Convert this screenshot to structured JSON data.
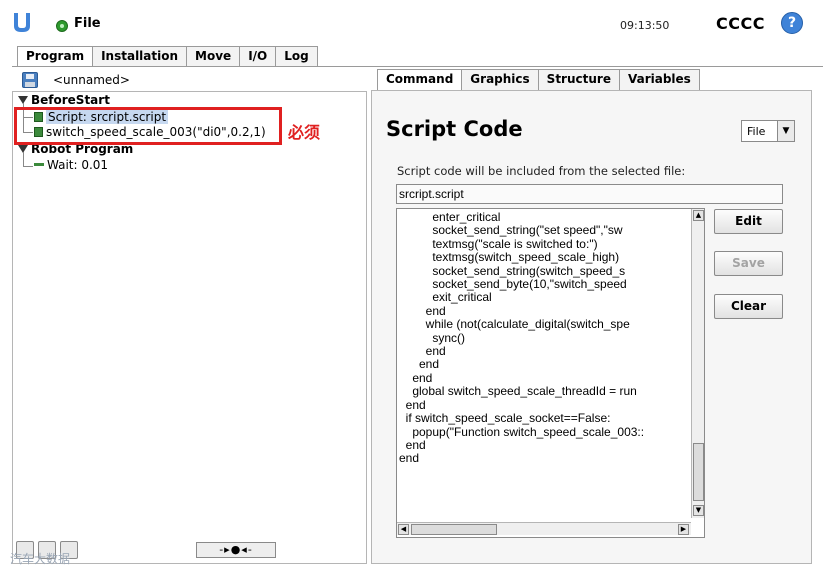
{
  "header": {
    "file_label": "File",
    "clock": "09:13:50",
    "robot_name": "CCCC",
    "help_glyph": "?",
    "logo_icon": "ur-logo-icon",
    "status_color": "#2e9a2e"
  },
  "main_tabs": [
    {
      "label": "Program",
      "active": true
    },
    {
      "label": "Installation",
      "active": false
    },
    {
      "label": "Move",
      "active": false
    },
    {
      "label": "I/O",
      "active": false
    },
    {
      "label": "Log",
      "active": false
    }
  ],
  "program": {
    "file_name": "<unnamed>",
    "tree": {
      "before_start": "BeforeStart",
      "script_node": "Script: srcript.script",
      "function_node": "switch_speed_scale_003(\"di0\",0.2,1)",
      "robot_program": "Robot Program",
      "wait_node": "Wait: 0.01"
    },
    "annotation": "必须",
    "nav_control": "-▸●◂-",
    "watermark": "汽车大数据"
  },
  "sub_tabs": [
    {
      "label": "Command",
      "active": true
    },
    {
      "label": "Graphics",
      "active": false
    },
    {
      "label": "Structure",
      "active": false
    },
    {
      "label": "Variables",
      "active": false
    }
  ],
  "command": {
    "title": "Script Code",
    "file_select": "File",
    "description": "Script code will be included from the selected file:",
    "path": "srcript.script",
    "code_lines": [
      "          enter_critical",
      "          socket_send_string(\"set speed\",\"sw",
      "          textmsg(\"scale is switched to:\")",
      "          textmsg(switch_speed_scale_high)",
      "          socket_send_string(switch_speed_s",
      "          socket_send_byte(10,\"switch_speed",
      "          exit_critical",
      "        end",
      "        while (not(calculate_digital(switch_spe",
      "          sync()",
      "        end",
      "      end",
      "    end",
      "    global switch_speed_scale_threadId = run",
      "  end",
      "  if switch_speed_scale_socket==False:",
      "    popup(\"Function switch_speed_scale_003::",
      "  end",
      "end"
    ],
    "buttons": {
      "edit": "Edit",
      "save": "Save",
      "clear": "Clear"
    }
  }
}
